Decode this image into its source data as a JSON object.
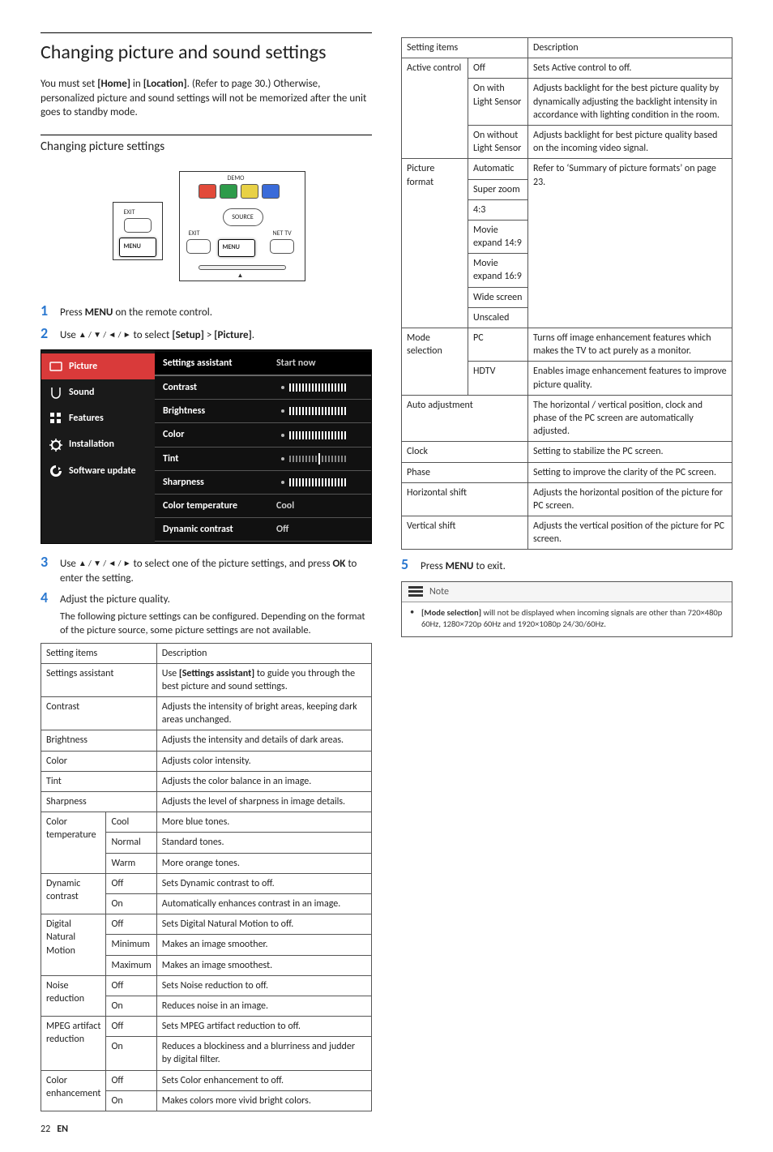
{
  "title": "Changing picture and sound settings",
  "intro": {
    "pre": "You must set ",
    "bold1": "[Home]",
    "mid1": " in ",
    "bold2": "[Location]",
    "ref": ". (Refer to page 30.)",
    "tail": "Otherwise, personalized picture and sound settings will not be memorized after the unit goes to standby mode."
  },
  "section2": "Changing picture settings",
  "remote": {
    "demo": "DEMO",
    "exit": "EXIT",
    "menu1": "MENU",
    "exit2": "EXIT",
    "menu2": "MENU",
    "source": "SOURCE",
    "nettv": "NET TV"
  },
  "steps": {
    "s1": {
      "n": "1",
      "pre": "Press ",
      "b": "MENU",
      "post": " on the remote control."
    },
    "s2": {
      "n": "2",
      "pre": "Use ",
      "nav": "▲ / ▼ / ◄ / ►",
      "mid": " to select ",
      "b1": "[Setup]",
      "gt": " > ",
      "b2": "[Picture]",
      "end": "."
    },
    "s3": {
      "n": "3",
      "pre": "Use ",
      "nav": "▲ / ▼ / ◄ / ►",
      "mid": " to select one of the picture settings, and press ",
      "b": "OK",
      "post": " to enter the setting."
    },
    "s4": {
      "n": "4",
      "t": "Adjust the picture quality.",
      "sub": "The following picture settings can be configured. Depending on the format of the picture source, some picture settings are not available."
    },
    "s5": {
      "n": "5",
      "pre": "Press ",
      "b": "MENU",
      "post": " to exit."
    }
  },
  "osd": {
    "side": [
      "Picture",
      "Sound",
      "Features",
      "Installation",
      "Software update"
    ],
    "rows": [
      {
        "lbl": "Settings assistant",
        "val": "Start now",
        "slider": null
      },
      {
        "lbl": "Contrast",
        "val": "",
        "slider": "high"
      },
      {
        "lbl": "Brightness",
        "val": "",
        "slider": "high"
      },
      {
        "lbl": "Color",
        "val": "",
        "slider": "high"
      },
      {
        "lbl": "Tint",
        "val": "",
        "slider": "mid"
      },
      {
        "lbl": "Sharpness",
        "val": "",
        "slider": "high"
      },
      {
        "lbl": "Color temperature",
        "val": "Cool",
        "slider": null
      },
      {
        "lbl": "Dynamic contrast",
        "val": "Off",
        "slider": null
      }
    ]
  },
  "table1": {
    "h1": "Setting items",
    "h2": "Description",
    "rows": [
      {
        "a": "Settings assistant",
        "b": "",
        "d": "Use [Settings assistant] to guide you through the best picture and sound settings.",
        "span": 2
      },
      {
        "a": "Contrast",
        "b": "",
        "d": "Adjusts the intensity of bright areas, keeping dark areas unchanged.",
        "span": 2
      },
      {
        "a": "Brightness",
        "b": "",
        "d": "Adjusts the intensity and details of dark areas.",
        "span": 2
      },
      {
        "a": "Color",
        "b": "",
        "d": "Adjusts color intensity.",
        "span": 2
      },
      {
        "a": "Tint",
        "b": "",
        "d": "Adjusts the color balance in an image.",
        "span": 2
      },
      {
        "a": "Sharpness",
        "b": "",
        "d": "Adjusts the level of sharpness in image details.",
        "span": 2
      }
    ],
    "groups": [
      {
        "a": "Color temperature",
        "subs": [
          {
            "b": "Cool",
            "d": "More blue tones."
          },
          {
            "b": "Normal",
            "d": "Standard tones."
          },
          {
            "b": "Warm",
            "d": "More orange tones."
          }
        ]
      },
      {
        "a": "Dynamic contrast",
        "subs": [
          {
            "b": "Off",
            "d": "Sets Dynamic contrast to off."
          },
          {
            "b": "On",
            "d": "Automatically enhances contrast in an image."
          }
        ]
      },
      {
        "a": "Digital Natural Motion",
        "subs": [
          {
            "b": "Off",
            "d": "Sets Digital Natural Motion to off."
          },
          {
            "b": "Minimum",
            "d": "Makes an image smoother."
          },
          {
            "b": "Maximum",
            "d": "Makes an image smoothest."
          }
        ]
      },
      {
        "a": "Noise reduction",
        "subs": [
          {
            "b": "Off",
            "d": "Sets Noise reduction to off."
          },
          {
            "b": "On",
            "d": "Reduces noise in an image."
          }
        ]
      },
      {
        "a": "MPEG artifact reduction",
        "subs": [
          {
            "b": "Off",
            "d": "Sets MPEG artifact reduction to off."
          },
          {
            "b": "On",
            "d": "Reduces a blockiness and a blurriness and judder by digital filter."
          }
        ]
      },
      {
        "a": "Color enhancement",
        "subs": [
          {
            "b": "Off",
            "d": "Sets Color enhancement to off."
          },
          {
            "b": "On",
            "d": "Makes colors more vivid bright colors."
          }
        ]
      }
    ]
  },
  "table2": {
    "h1": "Setting items",
    "h2": "Description",
    "groups": [
      {
        "a": "Active control",
        "subs": [
          {
            "b": "Off",
            "d": "Sets Active control to off."
          },
          {
            "b": "On with Light Sensor",
            "d": "Adjusts backlight for the best picture quality by dynamically adjusting the backlight intensity in accordance with lighting condition in the room."
          },
          {
            "b": "On without Light Sensor",
            "d": "Adjusts backlight for best picture quality based on the incoming video signal."
          }
        ]
      },
      {
        "a": "Picture format",
        "subs": [
          {
            "b": "Automatic"
          },
          {
            "b": "Super zoom"
          },
          {
            "b": "4:3"
          },
          {
            "b": "Movie expand 14:9"
          },
          {
            "b": "Movie expand 16:9"
          },
          {
            "b": "Wide screen"
          },
          {
            "b": "Unscaled"
          }
        ],
        "merged_d": "Refer to ‘Summary of picture formats’ on page 23."
      },
      {
        "a": "Mode selection",
        "subs": [
          {
            "b": "PC",
            "d": "Turns off image enhancement features which makes the TV to act purely as a monitor."
          },
          {
            "b": "HDTV",
            "d": "Enables image enhancement features to improve picture quality."
          }
        ]
      }
    ],
    "rows": [
      {
        "a": "Auto adjustment",
        "d": "The horizontal / vertical position, clock and phase of the PC screen are automatically adjusted."
      },
      {
        "a": "Clock",
        "d": "Setting to stabilize the PC screen."
      },
      {
        "a": "Phase",
        "d": "Setting to improve the clarity of the PC screen."
      },
      {
        "a": "Horizontal shift",
        "d": "Adjusts the horizontal position of the picture for PC screen."
      },
      {
        "a": "Vertical shift",
        "d": "Adjusts the vertical position of the picture for PC screen."
      }
    ]
  },
  "note": {
    "label": "Note",
    "bold": "[Mode selection]",
    "body": " will not be displayed when incoming signals are other than 720×480p 60Hz, 1280×720p 60Hz and 1920×1080p 24/30/60Hz."
  },
  "footer": {
    "page": "22",
    "lang": "EN"
  }
}
